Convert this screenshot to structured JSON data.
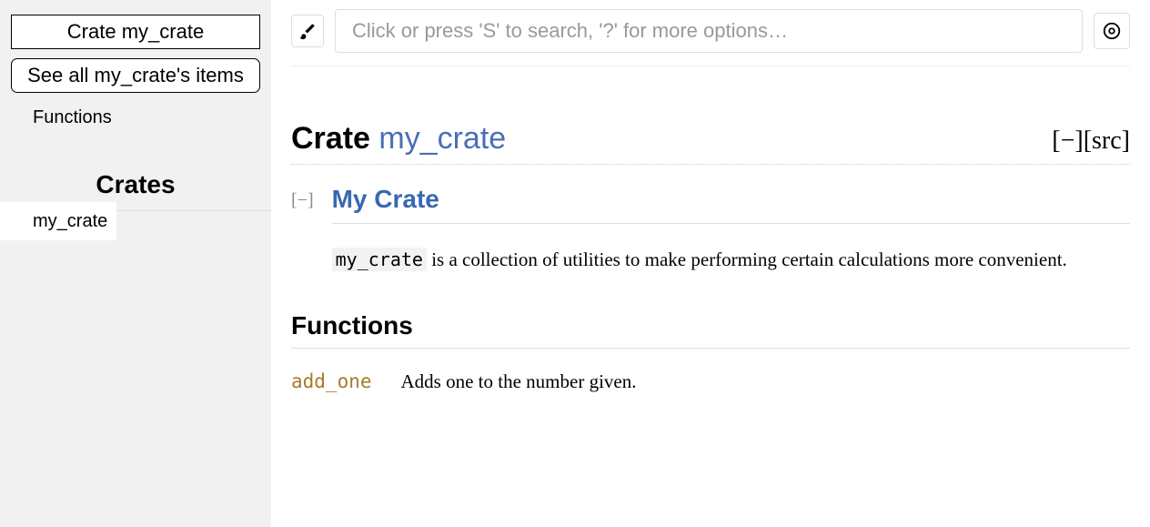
{
  "sidebar": {
    "crate_box_label": "Crate my_crate",
    "see_all_label": "See all my_crate's items",
    "section_links": [
      "Functions"
    ],
    "crates_heading": "Crates",
    "crates_list": [
      "my_crate"
    ]
  },
  "search": {
    "placeholder": "Click or press 'S' to search, '?' for more options…"
  },
  "title": {
    "prefix": "Crate ",
    "name": "my_crate",
    "collapse_all": "[−]",
    "src": "[src]"
  },
  "doc": {
    "toggle": "[−]",
    "heading": "My Crate",
    "code": "my_crate",
    "body_rest": " is a collection of utilities to make performing certain calculations more convenient."
  },
  "functions_section": {
    "heading": "Functions",
    "items": [
      {
        "name": "add_one",
        "desc": "Adds one to the number given."
      }
    ]
  }
}
